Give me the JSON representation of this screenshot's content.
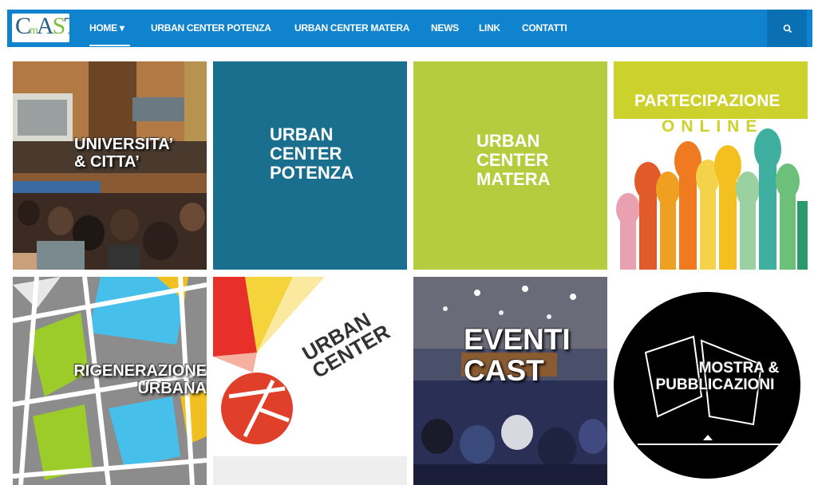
{
  "logo": {
    "text_c": "C",
    "text_a": "A",
    "text_s": "S",
    "text_t": "T"
  },
  "nav": {
    "items": [
      {
        "label": "HOME ▾"
      },
      {
        "label": "URBAN CENTER POTENZA"
      },
      {
        "label": "URBAN CENTER MATERA"
      },
      {
        "label": "NEWS"
      },
      {
        "label": "LINK"
      },
      {
        "label": "CONTATTI"
      }
    ],
    "search_icon": "search-icon"
  },
  "tiles": [
    {
      "line1": "UNIVERSITA’",
      "line2": "& CITTA’"
    },
    {
      "line1": "URBAN",
      "line2": "CENTER",
      "line3": "POTENZA"
    },
    {
      "line1": "URBAN",
      "line2": "CENTER",
      "line3": "MATERA"
    },
    {
      "line1": "PARTECIPAZIONE",
      "line2": "ONLINE"
    },
    {
      "line1": "RIGENERAZIONE",
      "line2": "URBANA"
    },
    {
      "line1": "URBAN",
      "line2": "CENTER"
    },
    {
      "line1": "EVENTI",
      "line2": "CAST"
    },
    {
      "line1": "MOSTRA &",
      "line2": "PUBBLICAZIONI"
    }
  ],
  "colors": {
    "nav": "#0f83cd",
    "potenza": "#1a6f8e",
    "matera": "#b6cc3f",
    "partecipazione_band": "#cdd12c"
  }
}
